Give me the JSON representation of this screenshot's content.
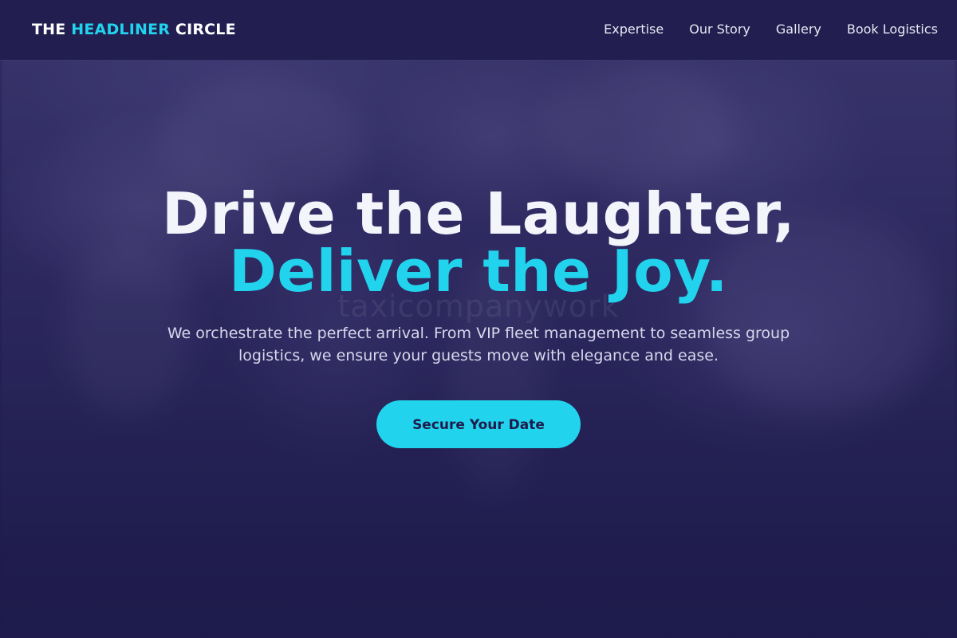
{
  "brand": {
    "prefix": "THE ",
    "accent": "HEADLINER",
    "suffix": " CIRCLE"
  },
  "nav": {
    "items": [
      {
        "label": "Expertise"
      },
      {
        "label": "Our Story"
      },
      {
        "label": "Gallery"
      },
      {
        "label": "Book Logistics"
      }
    ]
  },
  "hero": {
    "headline_line1": "Drive the Laughter,",
    "headline_line2": "Deliver the Joy.",
    "subtext": "We orchestrate the perfect arrival. From VIP fleet management to seamless group logistics, we ensure your guests move with elegance and ease.",
    "cta_label": "Secure Your Date",
    "watermark": "taxicompanywork"
  },
  "colors": {
    "accent": "#22d3ee",
    "background": "#1e1b4b",
    "navbar": "#221f50",
    "headline": "#f4f4fb"
  }
}
